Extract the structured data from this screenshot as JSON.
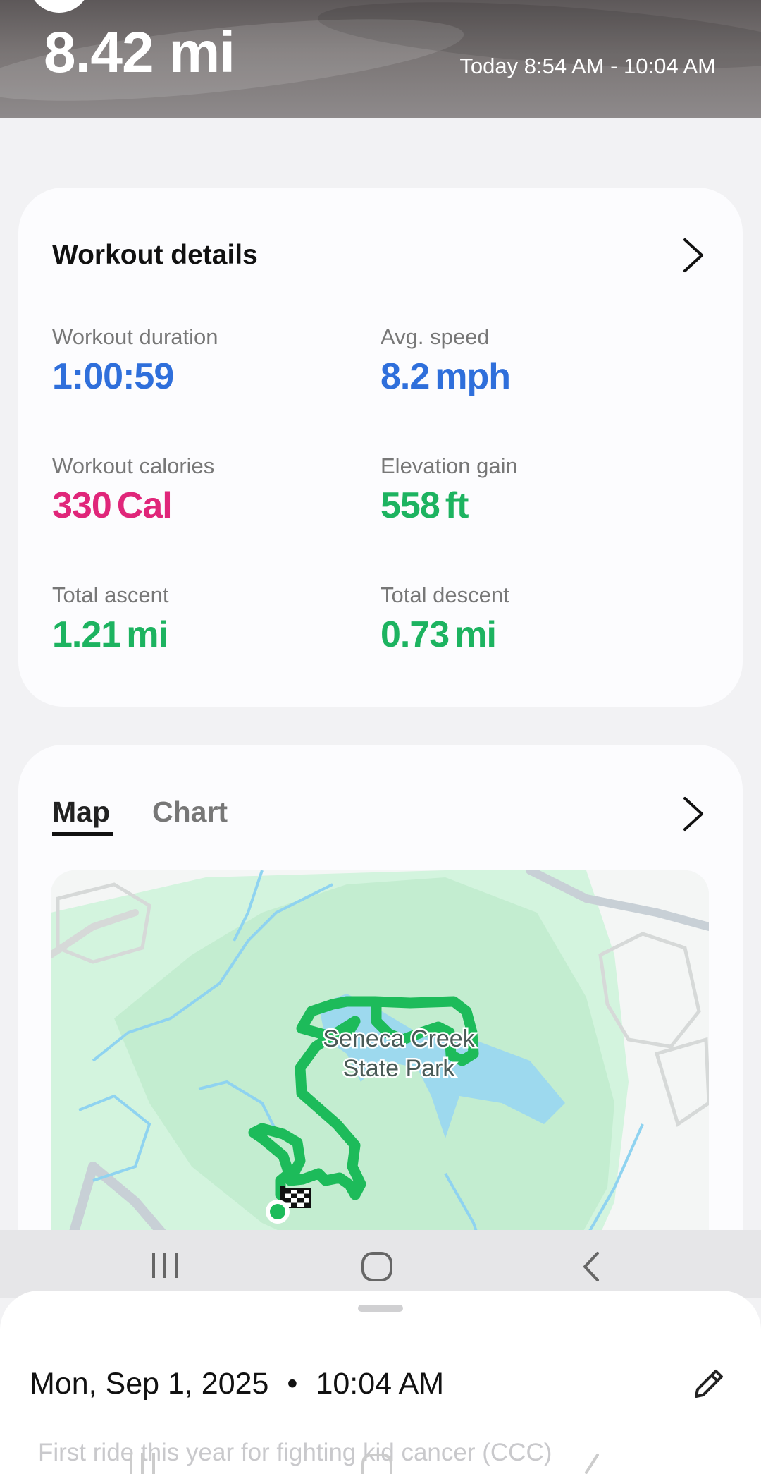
{
  "header": {
    "distance": "8.42 mi",
    "time_range": "Today 8:54 AM - 10:04 AM"
  },
  "workout_details": {
    "title": "Workout details",
    "metrics": [
      {
        "label": "Workout duration",
        "value": "1:00:59",
        "unit": "",
        "color": "#2f6fdb"
      },
      {
        "label": "Avg. speed",
        "value": "8.2",
        "unit": "mph",
        "color": "#2f6fdb"
      },
      {
        "label": "Workout calories",
        "value": "330",
        "unit": "Cal",
        "color": "#e0267a"
      },
      {
        "label": "Elevation gain",
        "value": "558",
        "unit": "ft",
        "color": "#1db360"
      },
      {
        "label": "Total ascent",
        "value": "1.21",
        "unit": "mi",
        "color": "#1db360"
      },
      {
        "label": "Total descent",
        "value": "0.73",
        "unit": "mi",
        "color": "#1db360"
      }
    ]
  },
  "map_section": {
    "tabs": [
      {
        "label": "Map",
        "selected": true
      },
      {
        "label": "Chart",
        "selected": false
      }
    ],
    "park_name_line1": "Seneca Creek",
    "park_name_line2": "State Park",
    "route_color": "#1dbb5a"
  },
  "nav_bar": {
    "icons": [
      "recent-apps-icon",
      "home-icon",
      "back-icon"
    ]
  },
  "bottom_sheet": {
    "date": "Mon, Sep 1, 2025",
    "time": "10:04 AM",
    "note": "First ride this year for fighting kid cancer (CCC)"
  }
}
